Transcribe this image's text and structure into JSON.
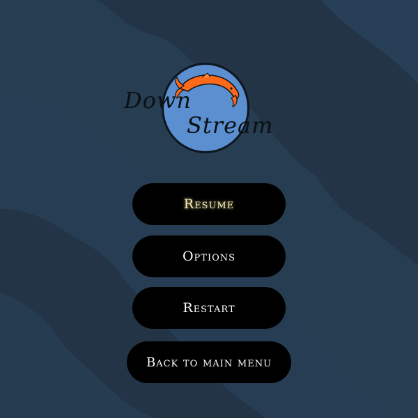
{
  "logo": {
    "word1": "Down",
    "word2": "Stream"
  },
  "menu": {
    "items": [
      {
        "label": "Resume",
        "selected": true
      },
      {
        "label": "Options",
        "selected": false
      },
      {
        "label": "Restart",
        "selected": false
      },
      {
        "label": "Back to main menu",
        "selected": false
      }
    ]
  },
  "colors": {
    "background_dark": "#223445",
    "background_light": "#263d52",
    "button": "#000000",
    "button_text": "#ffffff",
    "selected_text": "#f6efc0",
    "logo_circle": "#5b8fcf",
    "koi_orange": "#ff6a1a"
  }
}
